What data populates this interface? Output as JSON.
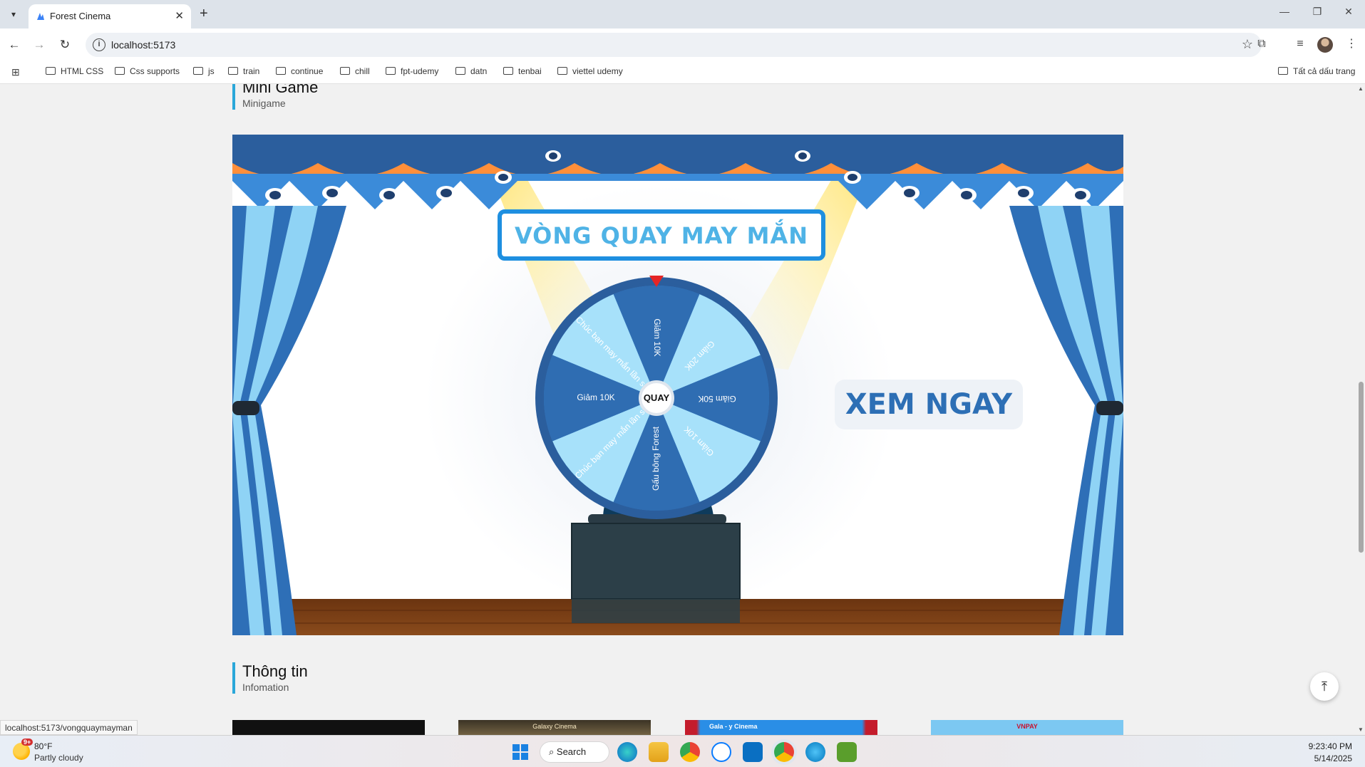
{
  "browser": {
    "tab_title": "Forest Cinema",
    "url": "localhost:5173",
    "bookmarks": [
      "HTML CSS",
      "Css supports",
      "js",
      "train",
      "continue",
      "chill",
      "fpt-udemy",
      "datn",
      "tenbai",
      "viettel udemy"
    ],
    "all_bookmarks": "Tất cả dấu trang"
  },
  "page": {
    "minigame": {
      "title": "Mini Game",
      "subtitle": "Minigame"
    },
    "banner": {
      "heading": "VÒNG QUAY MAY MẮN",
      "cta": "XEM NGAY",
      "spin_button": "QUAY",
      "wheel_segments": [
        "Giảm 10K",
        "Giảm 20K",
        "Giảm 50K",
        "Giảm 10K",
        "Gấu bông Forest",
        "Chúc bạn may mắn lần sau",
        "Giảm 10K",
        "Chúc bạn may mắn lần sau"
      ]
    },
    "info": {
      "title": "Thông tin",
      "subtitle": "Infomation"
    },
    "thumbnails": [
      "",
      "Galaxy Cinema",
      "Gala - y Cinema",
      "VNPAY"
    ]
  },
  "status_bar": {
    "link": "localhost:5173/vongquaymayman"
  },
  "taskbar": {
    "weather_badge": "9+",
    "temperature": "80°F",
    "weather": "Partly cloudy",
    "search_label": "Search",
    "time": "9:23:40 PM",
    "date": "5/14/2025"
  },
  "colors": {
    "accent": "#2aa7d9",
    "curtain_dark": "#2e6fb7",
    "curtain_light": "#8fd3f5",
    "stage_floor": "#7a3d14"
  }
}
